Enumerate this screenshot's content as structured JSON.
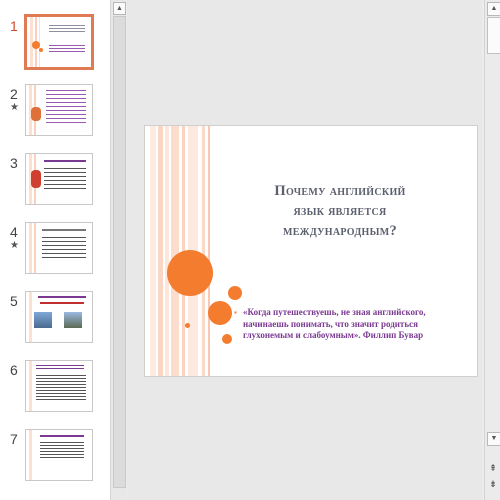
{
  "slides": [
    {
      "number": "1",
      "star": "",
      "active": true
    },
    {
      "number": "2",
      "star": "★",
      "active": false
    },
    {
      "number": "3",
      "star": "",
      "active": false
    },
    {
      "number": "4",
      "star": "★",
      "active": false
    },
    {
      "number": "5",
      "star": "",
      "active": false
    },
    {
      "number": "6",
      "star": "",
      "active": false
    },
    {
      "number": "7",
      "star": "",
      "active": false
    }
  ],
  "current_slide": {
    "title_line1": "Почему английский",
    "title_line2": "язык является",
    "title_line3": "международным?",
    "quote": "«Когда путешествуешь, не зная английского, начинаешь понимать, что значит родиться глухонемым и слабоумным».     Филлип Бувар"
  },
  "colors": {
    "accent_orange": "#f47c2f",
    "quote_purple": "#7b3a92",
    "title_gray": "#5c5f6e",
    "active_thumb_border": "#e07a52"
  },
  "icons": {
    "scroll_up": "▲",
    "scroll_down": "▼",
    "prev_slide": "⇞",
    "next_slide": "⇟"
  }
}
